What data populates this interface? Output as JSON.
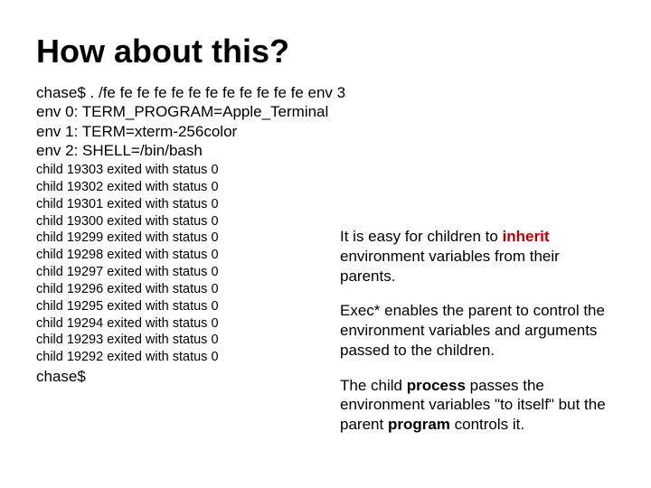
{
  "title": "How about this?",
  "term": {
    "line1": "chase$ . /fe fe fe fe fe fe fe fe fe fe fe fe env 3",
    "line2": "env 0: TERM_PROGRAM=Apple_Terminal",
    "line3": "env 1: TERM=xterm-256color",
    "line4": "env 2: SHELL=/bin/bash"
  },
  "children": [
    "child 19303 exited with status 0",
    "child 19302 exited with status 0",
    "child 19301 exited with status 0",
    "child 19300 exited with status 0",
    "child 19299 exited with status 0",
    "child 19298 exited with status 0",
    "child 19297 exited with status 0",
    "child 19296 exited with status 0",
    "child 19295 exited with status 0",
    "child 19294 exited with status 0",
    "child 19293 exited with status 0",
    "child 19292 exited with status 0"
  ],
  "prompt_end": "chase$",
  "note": {
    "p1_a": "It is easy for children to ",
    "p1_inherit": "inherit",
    "p1_b": " environment variables from their parents.",
    "p2": "Exec* enables the parent to control the environment variables and arguments passed to the children.",
    "p3_a": "The child ",
    "p3_process": "process",
    "p3_b": " passes the environment variables \"to itself\" but the parent ",
    "p3_program": "program",
    "p3_c": " controls it."
  }
}
